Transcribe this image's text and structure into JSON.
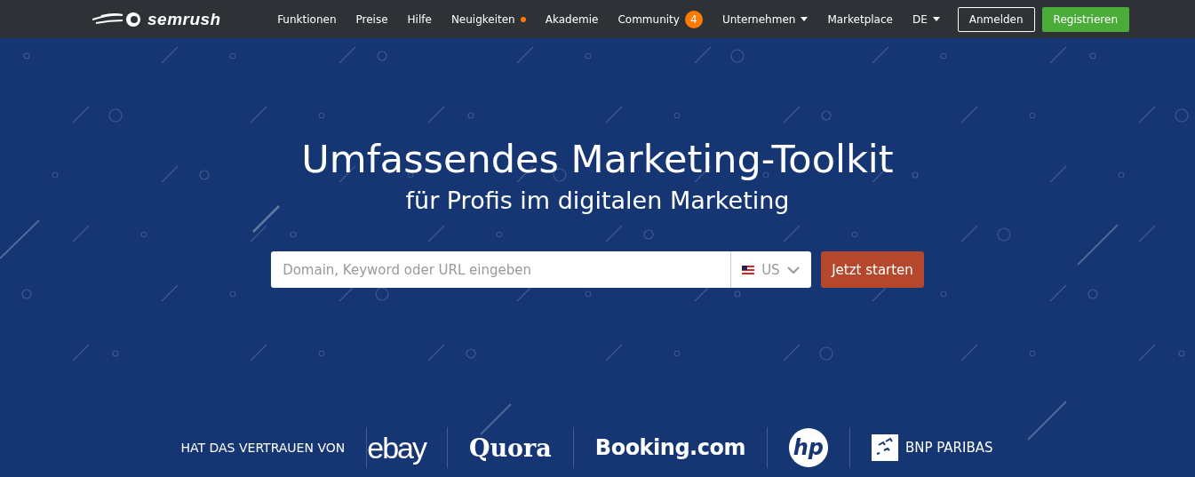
{
  "header": {
    "logo": "semrush",
    "nav": [
      {
        "label": "Funktionen",
        "kind": "plain"
      },
      {
        "label": "Preise",
        "kind": "plain"
      },
      {
        "label": "Hilfe",
        "kind": "plain"
      },
      {
        "label": "Neuigkeiten",
        "kind": "dot"
      },
      {
        "label": "Akademie",
        "kind": "plain"
      },
      {
        "label": "Community",
        "kind": "badge",
        "badge": "4"
      },
      {
        "label": "Unternehmen",
        "kind": "dropdown"
      },
      {
        "label": "Marketplace",
        "kind": "plain"
      },
      {
        "label": "DE",
        "kind": "dropdown"
      }
    ],
    "login": "Anmelden",
    "register": "Registrieren"
  },
  "hero": {
    "title": "Umfassendes Marketing-Toolkit",
    "subtitle": "für Profis im digitalen Marketing",
    "search": {
      "placeholder": "Domain, Keyword oder URL eingeben",
      "country": "US",
      "button": "Jetzt starten"
    }
  },
  "trust": {
    "label": "HAT DAS VERTRAUEN VON",
    "logos": [
      {
        "kind": "ebay",
        "text": "ebay"
      },
      {
        "kind": "quora",
        "text": "Quora"
      },
      {
        "kind": "booking",
        "text": "Booking.com"
      },
      {
        "kind": "hp",
        "text": "hp"
      },
      {
        "kind": "bnp",
        "text": "BNP PARIBAS"
      }
    ]
  }
}
